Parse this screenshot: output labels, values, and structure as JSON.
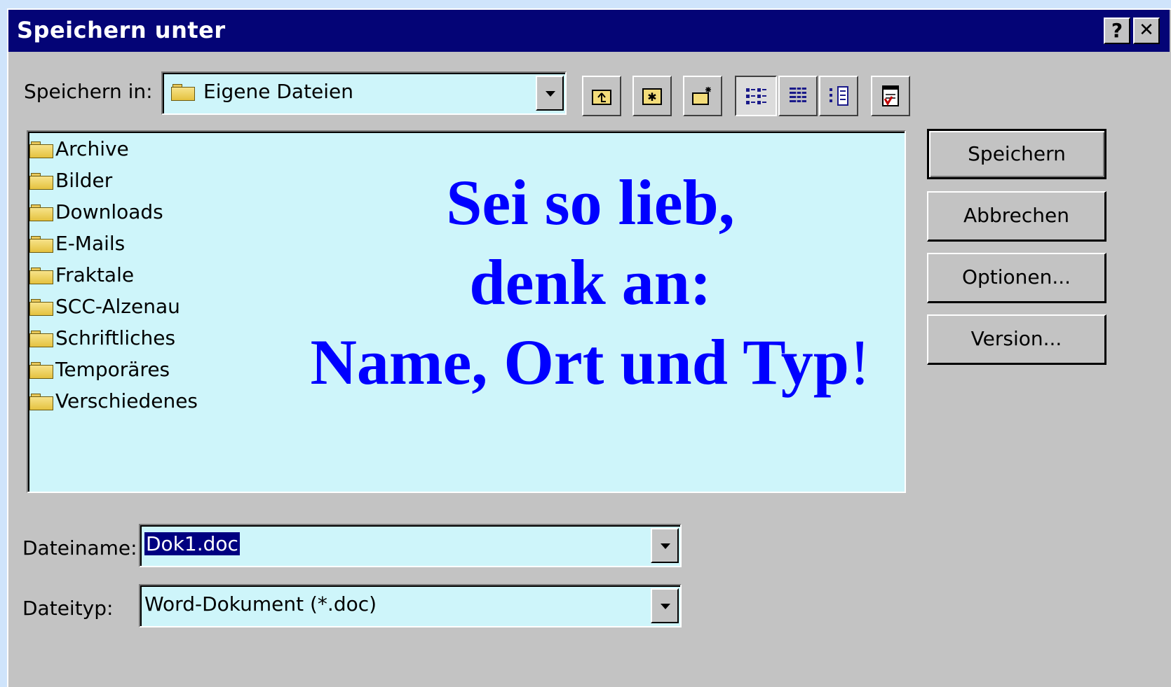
{
  "window": {
    "title": "Speichern unter",
    "help_label": "?",
    "close_label": "✕"
  },
  "location": {
    "label": "Speichern in:",
    "value": "Eigene Dateien"
  },
  "toolbar": {
    "icons": [
      "up-one-level-icon",
      "desktop-icon",
      "new-folder-icon",
      "list-view-icon",
      "details-view-icon",
      "properties-view-icon",
      "commands-icon"
    ]
  },
  "files": [
    {
      "name": "Archive"
    },
    {
      "name": "Bilder"
    },
    {
      "name": "Downloads"
    },
    {
      "name": "E-Mails"
    },
    {
      "name": "Fraktale"
    },
    {
      "name": "SCC-Alzenau"
    },
    {
      "name": "Schriftliches"
    },
    {
      "name": "Temporäres"
    },
    {
      "name": "Verschiedenes"
    }
  ],
  "overlay": {
    "line1": "Sei so lieb,",
    "line2": "denk an:",
    "line3": "Name, Ort und Typ",
    "line3_end": "!"
  },
  "buttons": {
    "save": "Speichern",
    "cancel": "Abbrechen",
    "options": "Optionen...",
    "version": "Version..."
  },
  "filename": {
    "label": "Dateiname:",
    "value": "Dok1.doc"
  },
  "filetype": {
    "label": "Dateityp:",
    "value": "Word-Dokument (*.doc)"
  },
  "colors": {
    "background": "#cfe4fb",
    "titlebar": "#040476",
    "field": "#cef5fa",
    "overlay_text": "#0000ff"
  }
}
